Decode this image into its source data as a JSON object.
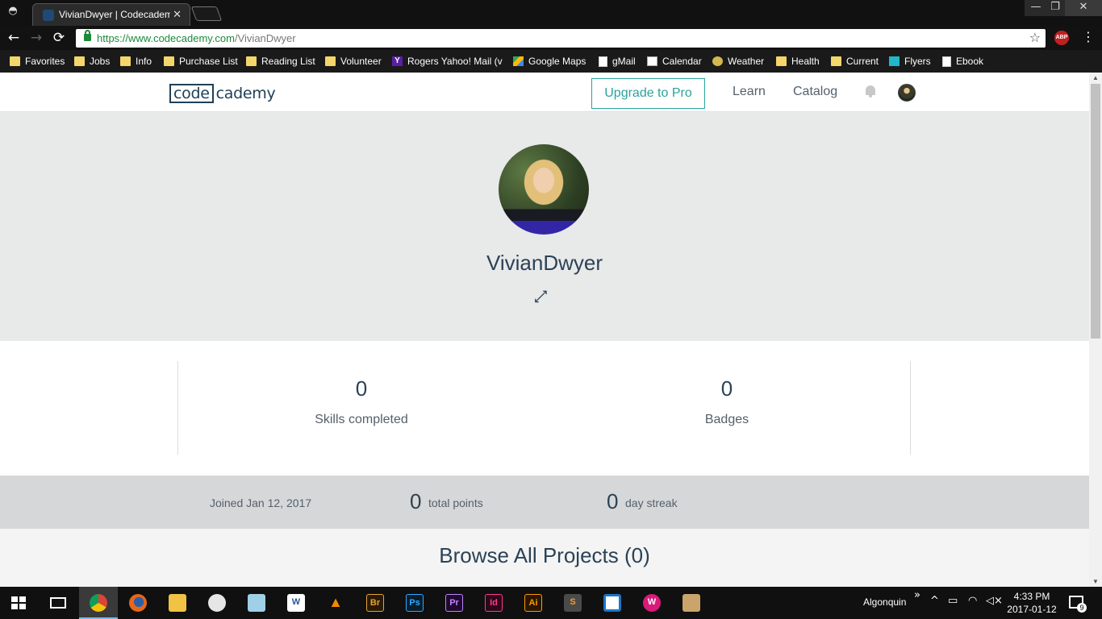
{
  "browser": {
    "tab_title": "VivianDwyer | Codecademy",
    "tab_close": "✕",
    "window_controls": {
      "minimize": "—",
      "maximize": "❐",
      "close": "✕"
    },
    "nav": {
      "back": "←",
      "forward": "→",
      "reload": "⟳"
    },
    "url_host": "https://www.codecademy.com",
    "url_path": "/VivianDwyer",
    "bookmark_star": "☆",
    "abp_label": "ABP",
    "menu": "⋮",
    "bookmarks": [
      {
        "label": "Favorites",
        "icon": "folder-icon"
      },
      {
        "label": "Jobs",
        "icon": "folder-icon"
      },
      {
        "label": "Info",
        "icon": "folder-icon"
      },
      {
        "label": "Purchase List",
        "icon": "folder-icon"
      },
      {
        "label": "Reading List",
        "icon": "folder-icon"
      },
      {
        "label": "Volunteer",
        "icon": "folder-icon"
      },
      {
        "label": "Rogers Yahoo! Mail (v",
        "icon": "yahoo-icon"
      },
      {
        "label": "Google Maps",
        "icon": "maps-icon"
      },
      {
        "label": "gMail",
        "icon": "page-icon"
      },
      {
        "label": "Calendar",
        "icon": "calendar-icon"
      },
      {
        "label": "Weather",
        "icon": "weather-icon"
      },
      {
        "label": "Health",
        "icon": "folder-icon"
      },
      {
        "label": "Current",
        "icon": "folder-icon"
      },
      {
        "label": "Flyers",
        "icon": "flyers-icon"
      },
      {
        "label": "Ebook",
        "icon": "page-icon"
      }
    ]
  },
  "site": {
    "logo_box": "code",
    "logo_rest": "cademy",
    "upgrade_label": "Upgrade to Pro",
    "nav": {
      "learn": "Learn",
      "catalog": "Catalog"
    }
  },
  "profile": {
    "username": "VivianDwyer",
    "link_icon": "⟷",
    "skills_completed": "0",
    "skills_label": "Skills completed",
    "badges": "0",
    "badges_label": "Badges",
    "joined": "Joined Jan 12, 2017",
    "total_points": "0",
    "total_points_label": "total points",
    "day_streak": "0",
    "day_streak_label": "day streak",
    "projects_title": "Browse All Projects (0)"
  },
  "taskbar": {
    "apps": [
      "chrome",
      "firefox",
      "file-explorer",
      "paint",
      "notepad",
      "word",
      "vlc",
      "bridge",
      "photoshop",
      "premiere",
      "indesign",
      "illustrator",
      "sublime",
      "remote",
      "wamp",
      "scanner"
    ],
    "app_labels": {
      "word": "W",
      "bridge": "Br",
      "photoshop": "Ps",
      "premiere": "Pr",
      "indesign": "Id",
      "illustrator": "Ai",
      "sublime": "S",
      "wamp": "W"
    },
    "network_name": "Algonquin",
    "tray_overflow": "»",
    "tray_chevron": "^",
    "clock_time": "4:33 PM",
    "clock_date": "2017-01-12",
    "notification_count": "9"
  },
  "colors": {
    "accent_teal": "#29a49a",
    "heading_navy": "#2b4256",
    "hero_bg": "#e8e9e9"
  }
}
